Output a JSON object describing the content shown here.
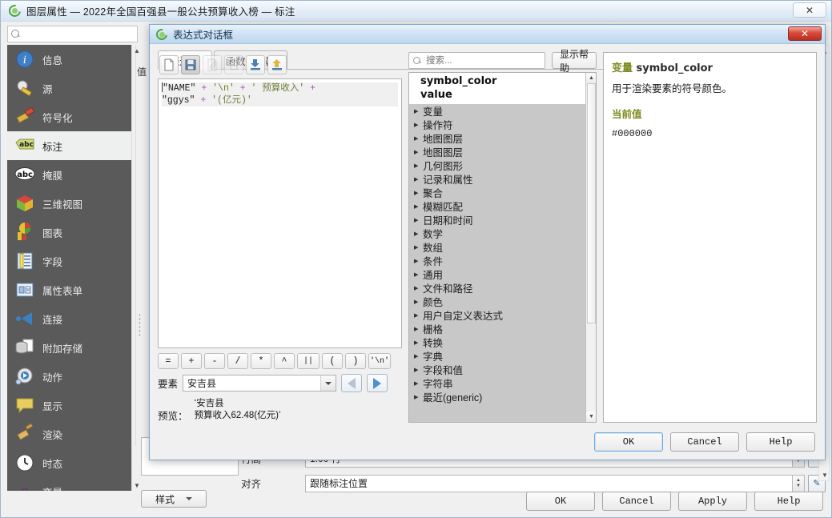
{
  "main_window": {
    "title": "图层属性 — 2022年全国百强县一般公共预算收入榜 — 标注",
    "logo_icon": "qgis-logo-icon",
    "close_label": "✕",
    "search": {
      "placeholder": "",
      "value": "",
      "icon": "search-icon"
    },
    "sidebar": {
      "items": [
        {
          "label": "信息",
          "icon": "info-icon",
          "selected": false
        },
        {
          "label": "源",
          "icon": "source-wrench-icon",
          "selected": false
        },
        {
          "label": "符号化",
          "icon": "symbology-brush-icon",
          "selected": false
        },
        {
          "label": "标注",
          "icon": "labels-abc-icon",
          "selected": true
        },
        {
          "label": "掩膜",
          "icon": "mask-abc-icon",
          "selected": false
        },
        {
          "label": "三维视图",
          "icon": "3d-view-cube-icon",
          "selected": false
        },
        {
          "label": "图表",
          "icon": "diagram-chart-icon",
          "selected": false
        },
        {
          "label": "字段",
          "icon": "fields-table-icon",
          "selected": false
        },
        {
          "label": "属性表单",
          "icon": "attributes-form-icon",
          "selected": false
        },
        {
          "label": "连接",
          "icon": "joins-icon",
          "selected": false
        },
        {
          "label": "附加存储",
          "icon": "auxiliary-storage-icon",
          "selected": false
        },
        {
          "label": "动作",
          "icon": "actions-gear-icon",
          "selected": false
        },
        {
          "label": "显示",
          "icon": "display-balloon-icon",
          "selected": false
        },
        {
          "label": "渲染",
          "icon": "rendering-broom-icon",
          "selected": false
        },
        {
          "label": "时态",
          "icon": "temporal-clock-icon",
          "selected": false
        },
        {
          "label": "变量",
          "icon": "variables-epsilon-icon",
          "selected": false
        }
      ],
      "scroll_up_icon": "chevron-up-icon",
      "scroll_down_icon": "chevron-down-icon"
    },
    "style_button": {
      "label": "样式",
      "caret_icon": "chevron-down-icon"
    },
    "background_fields": [
      {
        "label": "行高",
        "value": "1.00 行",
        "spin_icon": "spinner-icon",
        "data_define_icon": "data-defined-override-icon"
      },
      {
        "label": "对齐",
        "value": "跟随标注位置",
        "spin_icon": "spinner-icon",
        "data_define_icon": "data-defined-override-icon"
      }
    ],
    "under_label": "值",
    "buttons": [
      {
        "label": "OK",
        "primary": false
      },
      {
        "label": "Cancel",
        "primary": false
      },
      {
        "label": "Apply",
        "primary": false
      },
      {
        "label": "Help",
        "primary": false
      }
    ]
  },
  "expression_dialog": {
    "title": "表达式对话框",
    "logo_icon": "qgis-logo-icon",
    "close_label": "✕",
    "tabs": [
      {
        "label": "表达式",
        "active": true
      },
      {
        "label": "函数编辑器",
        "active": false
      }
    ],
    "toolbar": [
      {
        "name": "new-expression-button",
        "icon": "new-file-icon",
        "enabled": true,
        "pressed": false
      },
      {
        "name": "save-expression-button",
        "icon": "save-floppy-icon",
        "enabled": true,
        "pressed": true
      },
      {
        "name": "edit-expression-button",
        "icon": "edit-pencil-icon",
        "enabled": false,
        "pressed": false
      },
      {
        "name": "delete-expression-button",
        "icon": "trash-icon",
        "enabled": false,
        "pressed": false
      },
      {
        "name": "import-expressions-button",
        "icon": "import-down-arrow-icon",
        "enabled": true,
        "pressed": false
      },
      {
        "name": "export-expressions-button",
        "icon": "export-up-arrow-icon",
        "enabled": true,
        "pressed": false
      }
    ],
    "expression": {
      "line1": {
        "field": "\"NAME\"",
        "op1": "+",
        "esc": "'\\n'",
        "op2": "+",
        "str": "' 预算收入'",
        "op3": "+"
      },
      "line2": {
        "field": "\"ggys\"",
        "op1": "+",
        "str": "'(亿元)'"
      }
    },
    "operator_buttons": [
      "=",
      "+",
      "-",
      "/",
      "*",
      "^",
      "||",
      "(",
      ")",
      "'\\n'"
    ],
    "feature": {
      "label": "要素",
      "value": "安吉县",
      "caret_icon": "chevron-down-icon",
      "prev_icon": "prev-feature-icon",
      "next_icon": "next-feature-icon"
    },
    "preview": {
      "label": "预览：",
      "line1": "‘安吉县",
      "line2": "预算收入62.48(亿元)’"
    },
    "search": {
      "placeholder": "搜索...",
      "value": "",
      "icon": "search-icon"
    },
    "show_help_button": "显示帮助",
    "tree_header": [
      "symbol_color",
      "value"
    ],
    "tree_items": [
      "变量",
      "操作符",
      "地图图层",
      "地图图层",
      "几何图形",
      "记录和属性",
      "聚合",
      "模糊匹配",
      "日期和时间",
      "数学",
      "数组",
      "条件",
      "通用",
      "文件和路径",
      "颜色",
      "用户自定义表达式",
      "栅格",
      "转换",
      "字典",
      "字段和值",
      "字符串",
      "最近(generic)"
    ],
    "help": {
      "heading_prefix": "变量",
      "heading_name": "symbol_color",
      "description": "用于渲染要素的符号颜色。",
      "current_value_label": "当前值",
      "current_value": "#000000"
    },
    "buttons": [
      {
        "label": "OK",
        "primary": true
      },
      {
        "label": "Cancel",
        "primary": false
      },
      {
        "label": "Help",
        "primary": false
      }
    ]
  }
}
